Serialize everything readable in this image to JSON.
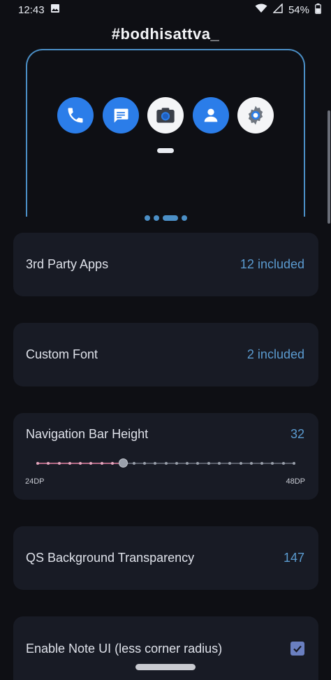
{
  "status_bar": {
    "time": "12:43",
    "battery_percent": "54%",
    "icons": [
      "gallery-icon",
      "wifi-icon",
      "signal-icon",
      "battery-icon"
    ]
  },
  "header": {
    "title": "#bodhisattva_"
  },
  "preview": {
    "accent_color": "#4b8fc6",
    "apps": [
      "phone-icon",
      "messages-icon",
      "camera-icon",
      "contacts-icon",
      "settings-icon"
    ],
    "page_count": 4,
    "active_page": 3
  },
  "settings": {
    "third_party_apps": {
      "label": "3rd Party Apps",
      "value": "12 included"
    },
    "custom_font": {
      "label": "Custom Font",
      "value": "2 included"
    },
    "nav_bar_height": {
      "label": "Navigation Bar Height",
      "value": "32",
      "min_label": "24DP",
      "max_label": "48DP",
      "min": 24,
      "max": 48,
      "current": 32
    },
    "qs_transparency": {
      "label": "QS Background Transparency",
      "value": "147"
    },
    "note_ui": {
      "label": "Enable Note UI (less corner radius)",
      "checked": true
    }
  },
  "colors": {
    "background": "#0e0f14",
    "card": "#181b25",
    "value_text": "#5b9bd0",
    "slider_fill": "#b46a86"
  }
}
